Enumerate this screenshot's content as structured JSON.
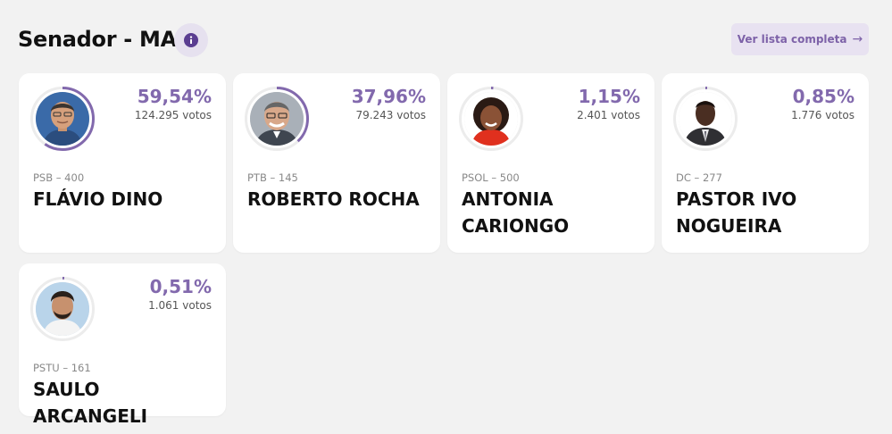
{
  "header": {
    "title": "Senador - MA",
    "info_icon": "info-icon",
    "full_list_label": "Ver lista completa",
    "full_list_icon": "arrow-right-icon"
  },
  "accent_color": "#8269ad",
  "candidates": [
    {
      "name": "FLÁVIO DINO",
      "party": "PSB – 400",
      "percent": "59,54%",
      "votes": "124.295 votos",
      "share": 0.5954,
      "photo_bg": "#3a6aa8"
    },
    {
      "name": "ROBERTO ROCHA",
      "party": "PTB – 145",
      "percent": "37,96%",
      "votes": "79.243 votos",
      "share": 0.3796,
      "photo_bg": "#a9b0b8"
    },
    {
      "name": "ANTONIA CARIONGO",
      "party": "PSOL – 500",
      "percent": "1,15%",
      "votes": "2.401 votos",
      "share": 0.0115,
      "photo_bg": "#ffffff"
    },
    {
      "name": "PASTOR IVO NOGUEIRA",
      "party": "DC – 277",
      "percent": "0,85%",
      "votes": "1.776 votos",
      "share": 0.0085,
      "photo_bg": "#ffffff"
    },
    {
      "name": "SAULO ARCANGELI",
      "party": "PSTU – 161",
      "percent": "0,51%",
      "votes": "1.061 votos",
      "share": 0.0051,
      "photo_bg": "#b9d4ea"
    }
  ]
}
